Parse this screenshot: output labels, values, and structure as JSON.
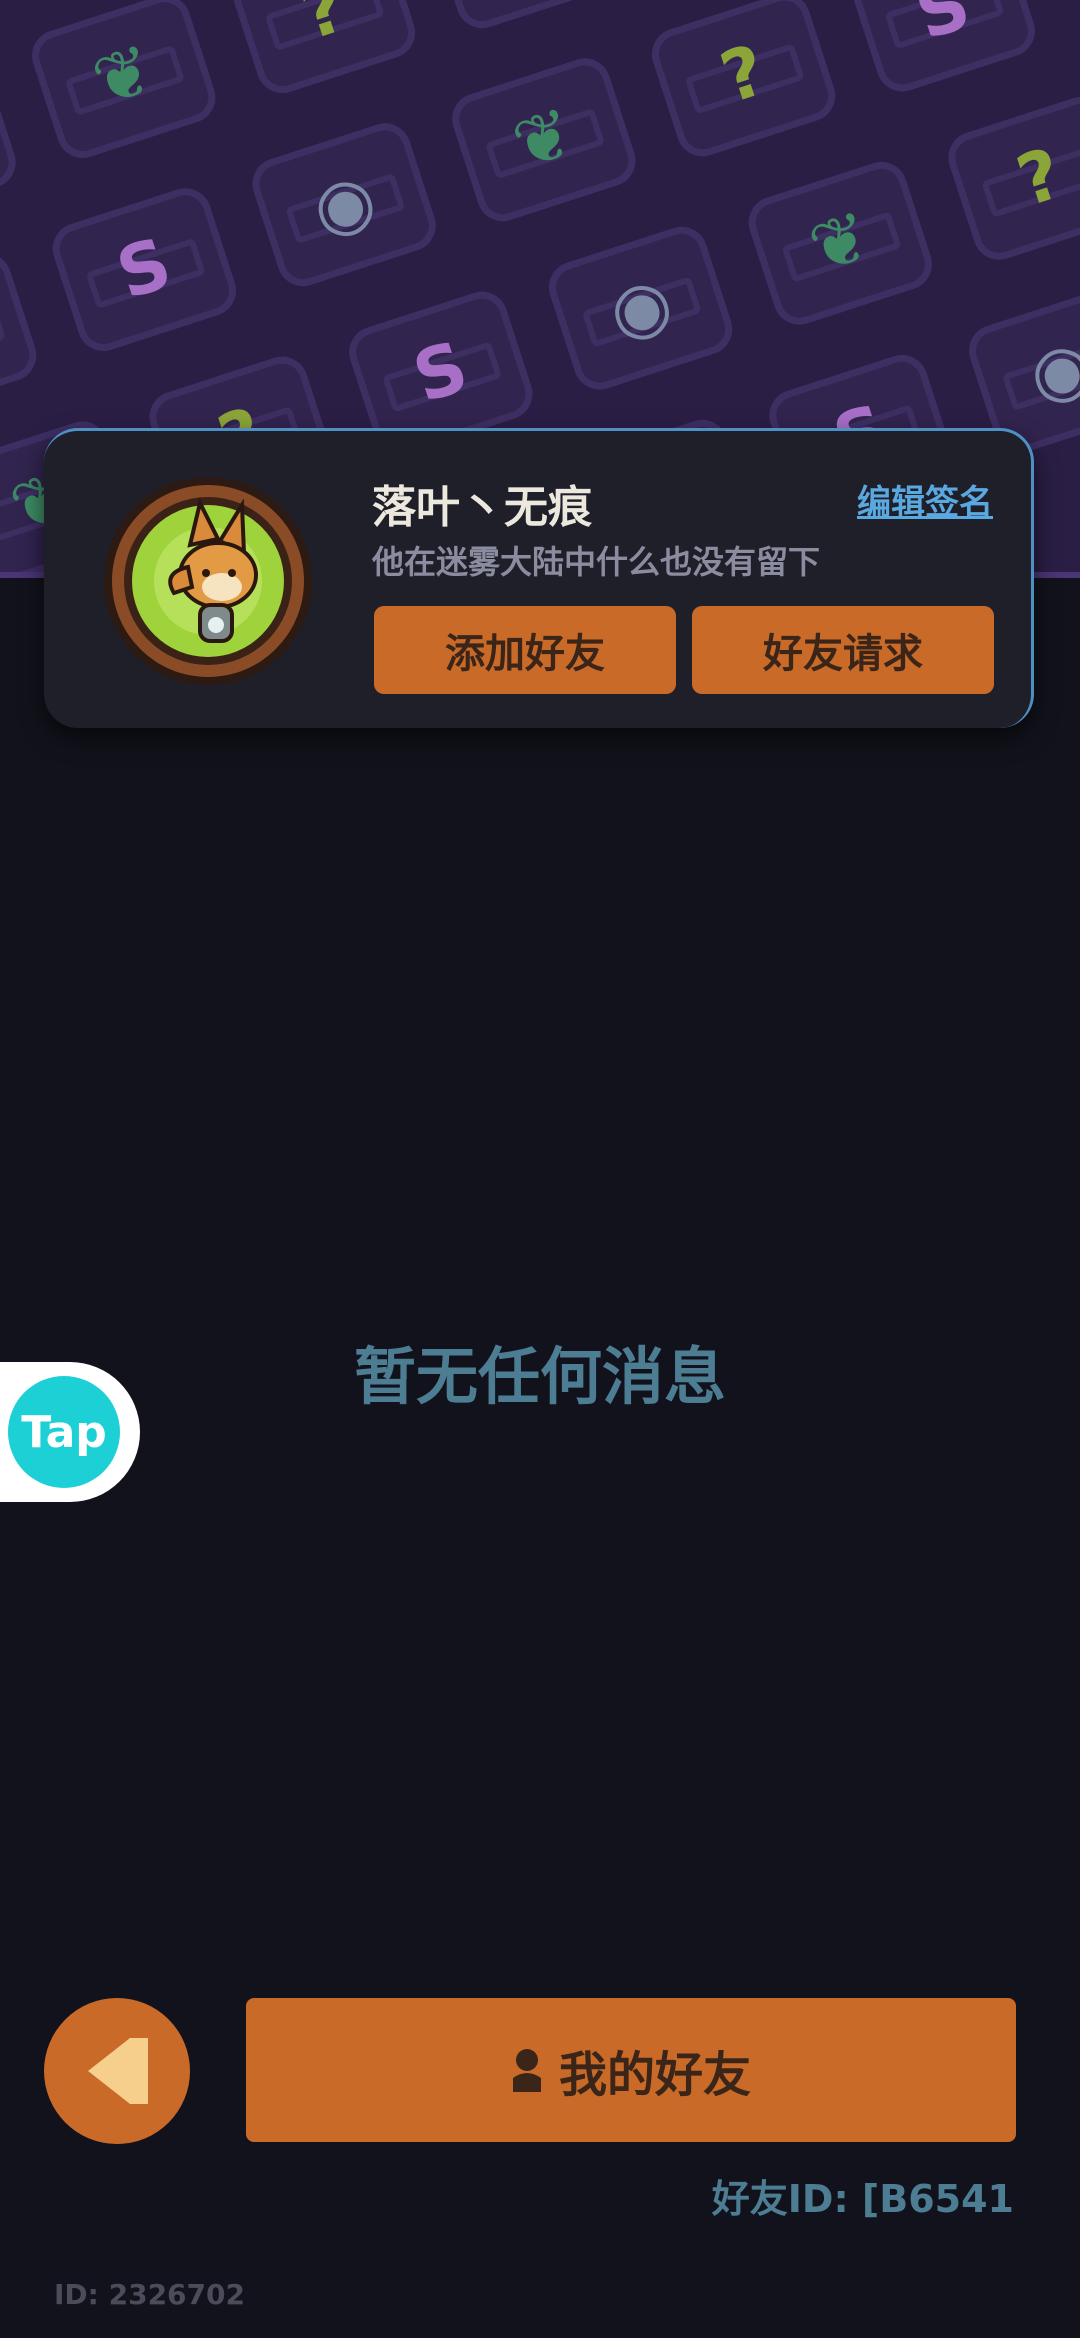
{
  "profile": {
    "username": "落叶丶无痕",
    "edit_signature_label": "编辑签名",
    "signature": "他在迷雾大陆中什么也没有留下",
    "add_friend_label": "添加好友",
    "friend_request_label": "好友请求"
  },
  "main": {
    "empty_message": "暂无任何消息"
  },
  "tap_badge": {
    "label": "Tap"
  },
  "bottom": {
    "back_icon": "triangle-left-icon",
    "my_friends_label": "我的好友",
    "my_friends_icon": "person-icon",
    "friend_id_label": "好友ID: [B6541",
    "user_id_label": "ID: 2326702"
  },
  "colors": {
    "accent": "#c96a29",
    "background": "#12121c",
    "banner": "#2a1e45",
    "link": "#5aa8e0",
    "muted": "#4d7d93"
  }
}
